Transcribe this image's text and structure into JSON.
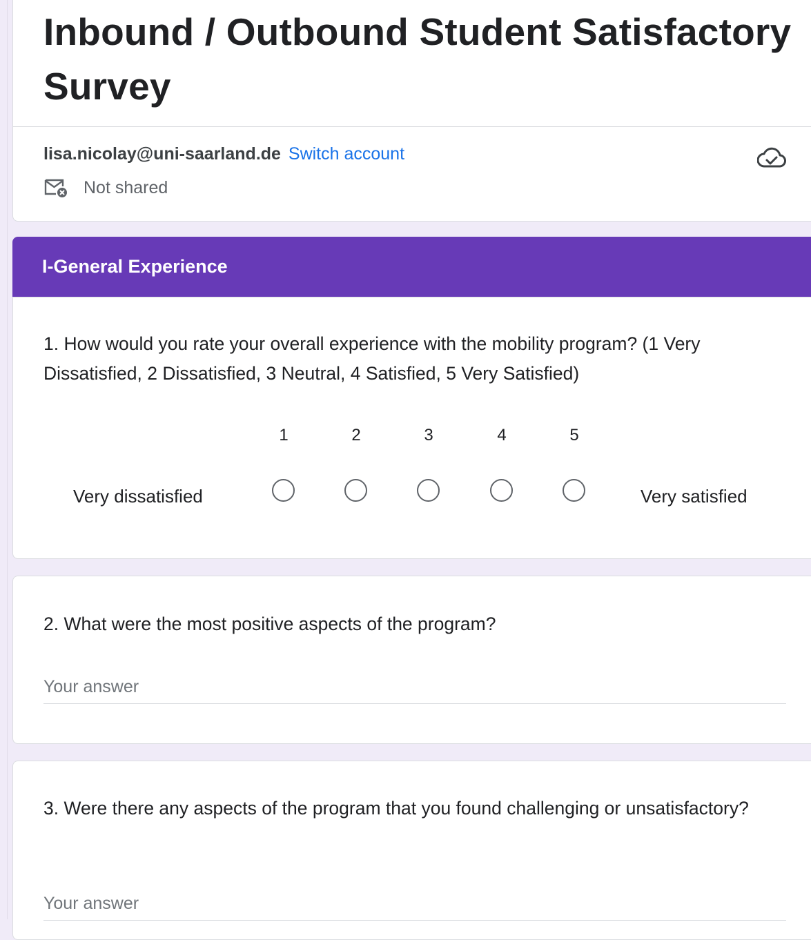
{
  "form": {
    "title": "Inbound / Outbound Student Satisfactory Survey",
    "account_email": "lisa.nicolay@uni-saarland.de",
    "switch_account": "Switch account",
    "shared_status": "Not shared",
    "icons": {
      "cloud": "cloud-check-icon",
      "mail": "mail-not-shared-icon"
    }
  },
  "section": {
    "title": "I-General Experience",
    "color": "#673ab7"
  },
  "questions": [
    {
      "text": "1.  How would you rate your overall experience with the mobility program? (1 Very Dissatisfied, 2 Dissatisfied, 3 Neutral, 4 Satisfied, 5 Very Satisfied)",
      "scale": [
        "1",
        "2",
        "3",
        "4",
        "5"
      ],
      "min_label": "Very dissatisfied",
      "max_label": "Very satisfied"
    },
    {
      "text": "2. What were the most positive aspects of the program?",
      "placeholder": "Your answer"
    },
    {
      "text": "3.  Were there any aspects of the program that you found challenging or unsatisfactory?",
      "placeholder": "Your answer"
    }
  ],
  "colors": {
    "background": "#f0ebf8",
    "link": "#1a73e8",
    "text": "#202124"
  }
}
